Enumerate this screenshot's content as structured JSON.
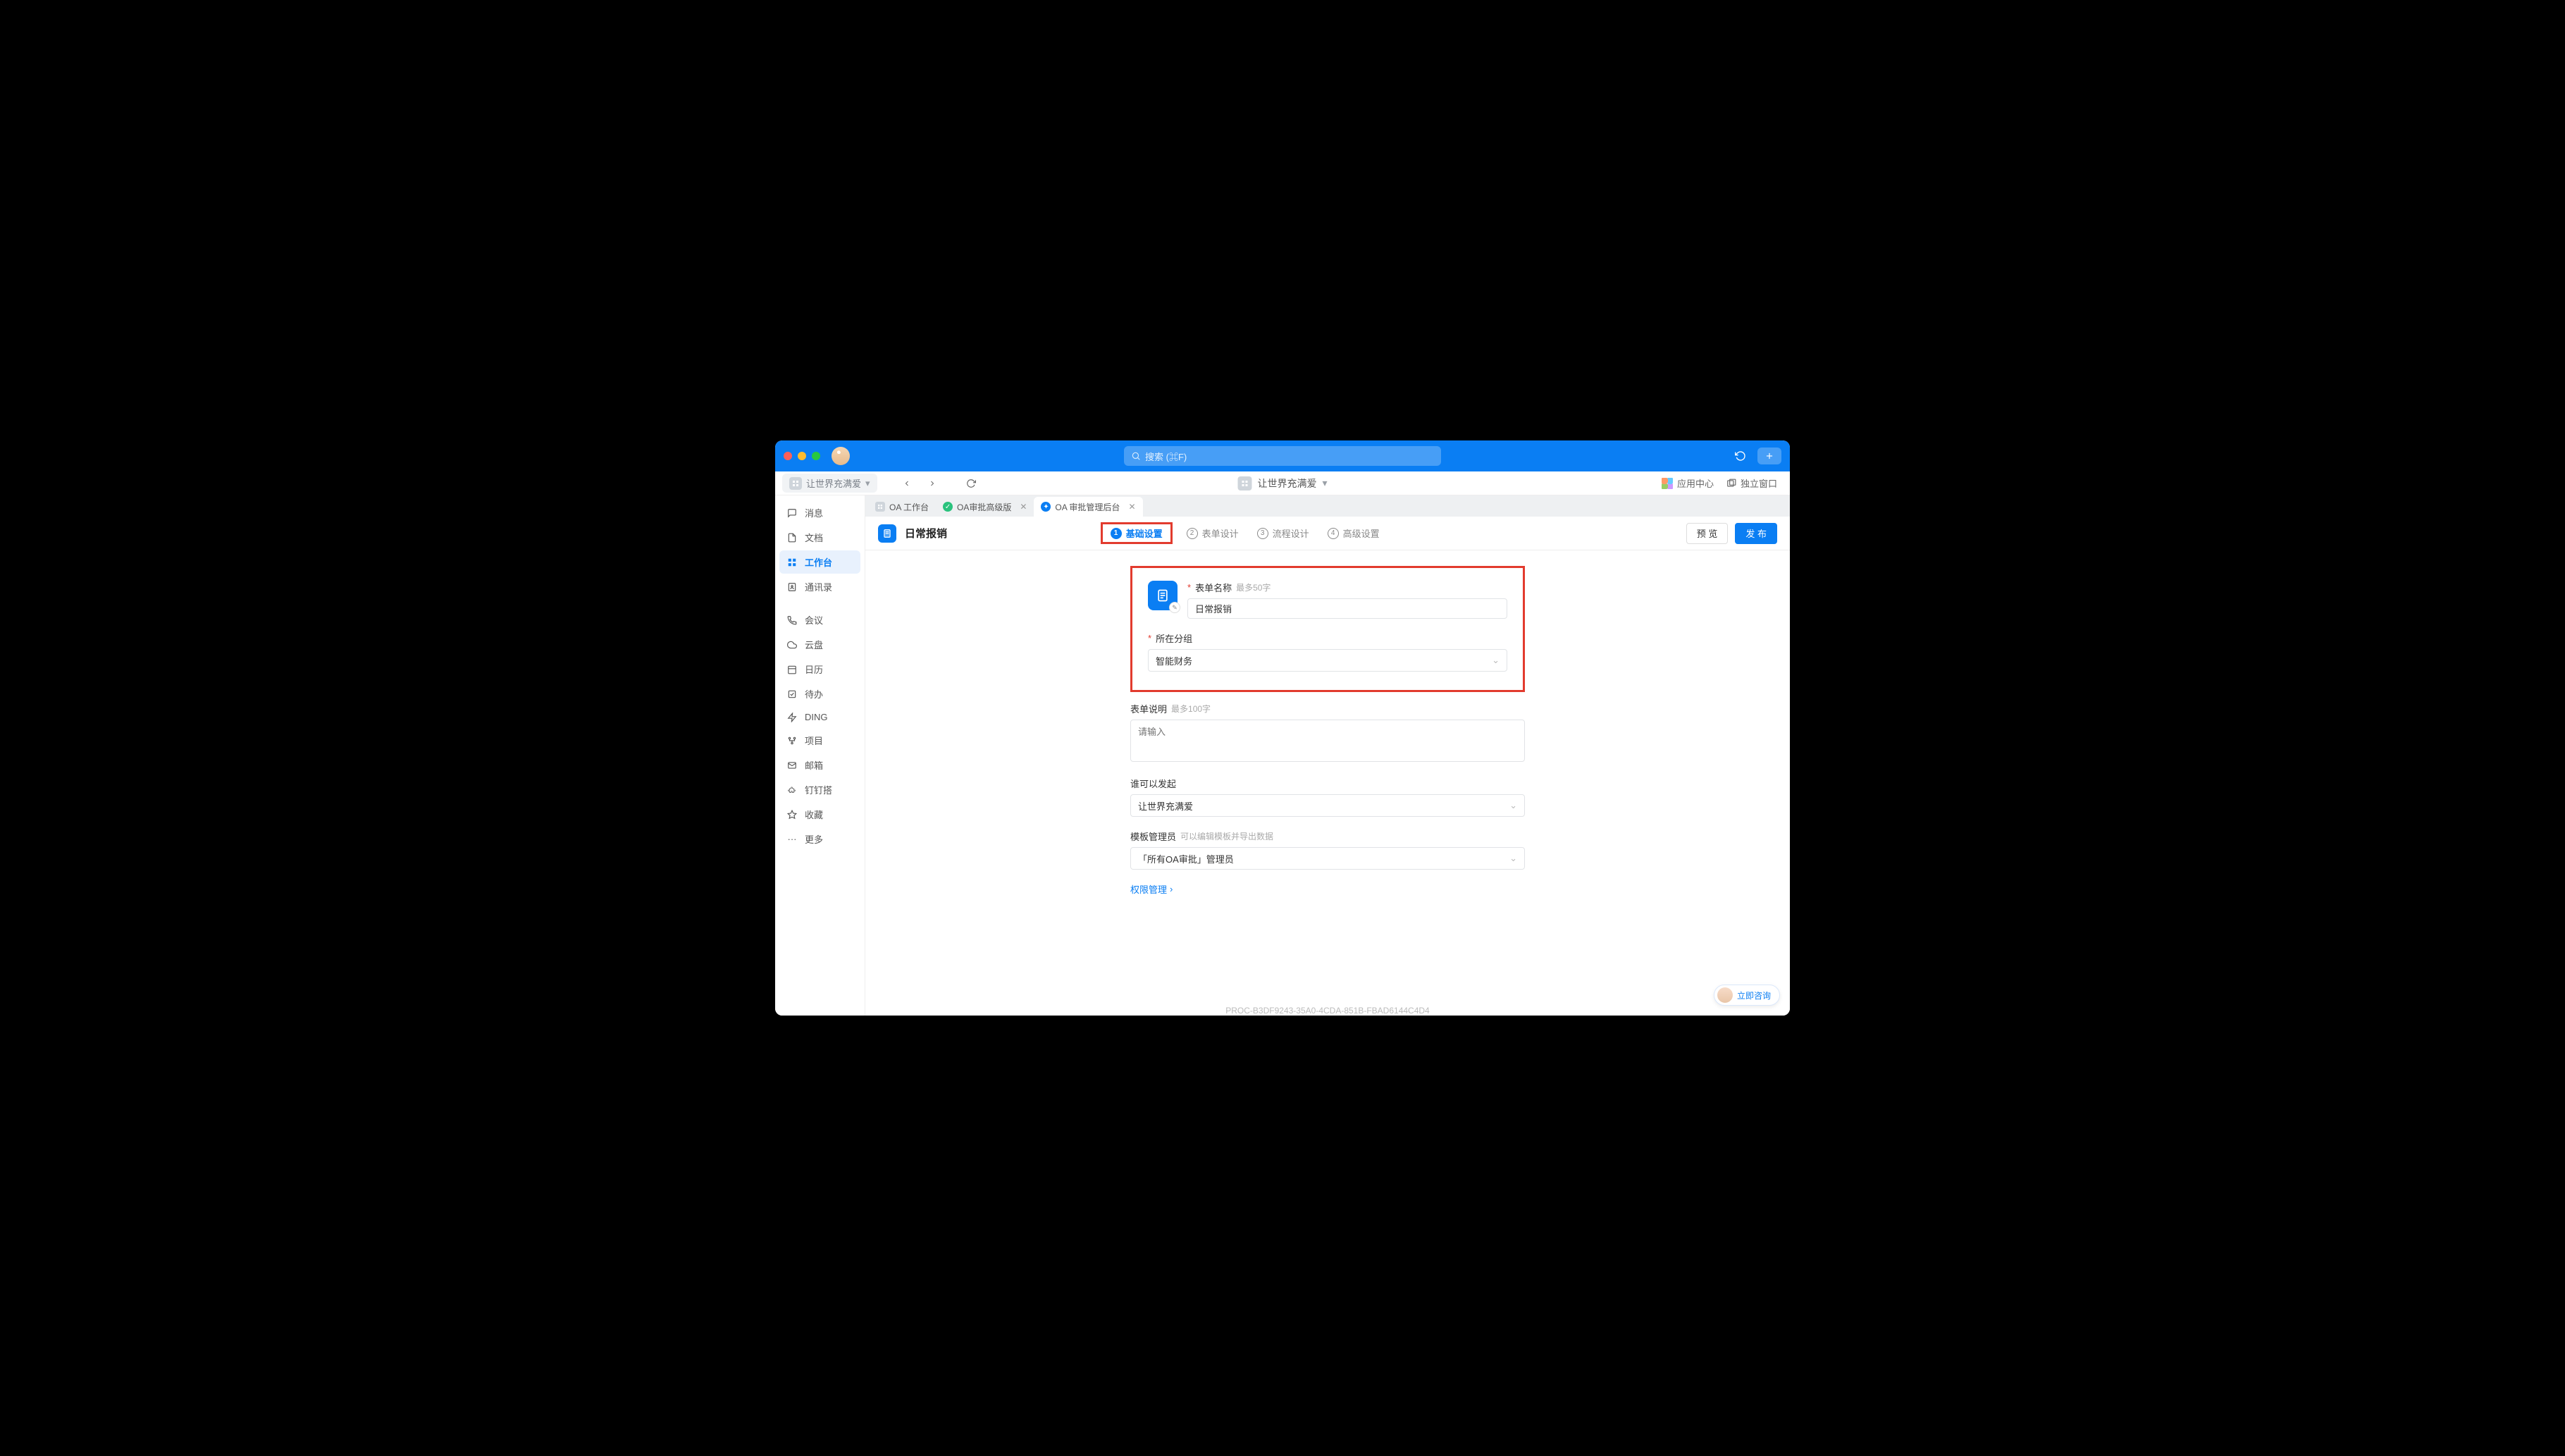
{
  "titlebar": {
    "search_placeholder": "搜索 (⌘F)"
  },
  "toolbar": {
    "workspace_name": "让世界充满爱",
    "center_app": "让世界充满爱",
    "app_center": "应用中心",
    "popout": "独立窗口"
  },
  "sidebar": {
    "messages": "消息",
    "docs": "文档",
    "workbench": "工作台",
    "contacts": "通讯录",
    "meeting": "会议",
    "cloud": "云盘",
    "calendar": "日历",
    "todo": "待办",
    "ding": "DING",
    "project": "项目",
    "mail": "邮箱",
    "dingda": "钉钉搭",
    "favorite": "收藏",
    "more": "更多"
  },
  "tabs": [
    {
      "label": "OA 工作台",
      "closable": false
    },
    {
      "label": "OA审批高级版",
      "closable": true
    },
    {
      "label": "OA 审批管理后台",
      "closable": true
    }
  ],
  "form_header": {
    "title": "日常报销",
    "steps": [
      "基础设置",
      "表单设计",
      "流程设计",
      "高级设置"
    ],
    "preview": "预 览",
    "publish": "发 布"
  },
  "form": {
    "name_label": "表单名称",
    "name_hint": "最多50字",
    "name_value": "日常报销",
    "group_label": "所在分组",
    "group_value": "智能财务",
    "desc_label": "表单说明",
    "desc_hint": "最多100字",
    "desc_placeholder": "请输入",
    "who_label": "谁可以发起",
    "who_value": "让世界充满爱",
    "admin_label": "模板管理员",
    "admin_hint": "可以编辑模板并导出数据",
    "admin_value": "「所有OA审批」管理员",
    "perm_link": "权限管理",
    "proc_id": "PROC-B3DF9243-35A0-4CDA-851B-FBAD6144C4D4"
  },
  "consult": "立即咨询"
}
